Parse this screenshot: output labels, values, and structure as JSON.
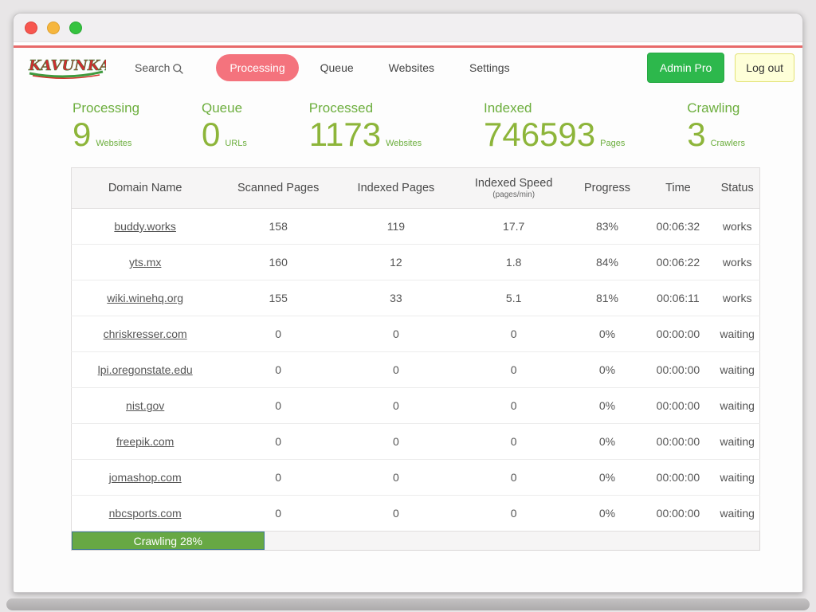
{
  "window": {
    "controls": [
      "close",
      "minimize",
      "maximize"
    ]
  },
  "navbar": {
    "logo_text": "KAVUNKA",
    "search_label": "Search",
    "items": [
      {
        "label": "Processing",
        "active": true
      },
      {
        "label": "Queue",
        "active": false
      },
      {
        "label": "Websites",
        "active": false
      },
      {
        "label": "Settings",
        "active": false
      }
    ],
    "admin_button": "Admin Pro",
    "logout_button": "Log out"
  },
  "stats": [
    {
      "label": "Processing",
      "value": "9",
      "unit": "Websites"
    },
    {
      "label": "Queue",
      "value": "0",
      "unit": "URLs"
    },
    {
      "label": "Processed",
      "value": "1173",
      "unit": "Websites"
    },
    {
      "label": "Indexed",
      "value": "746593",
      "unit": "Pages"
    },
    {
      "label": "Crawling",
      "value": "3",
      "unit": "Crawlers"
    }
  ],
  "table": {
    "headers": [
      "Domain Name",
      "Scanned Pages",
      "Indexed Pages",
      "Indexed Speed",
      "Progress",
      "Time",
      "Status"
    ],
    "speed_subtitle": "(pages/min)",
    "col_keys": [
      "domain",
      "scanned",
      "indexed",
      "speed",
      "progress",
      "time",
      "status"
    ],
    "rows": [
      {
        "domain": "buddy.works",
        "scanned": "158",
        "indexed": "119",
        "speed": "17.7",
        "progress": "83%",
        "time": "00:06:32",
        "status": "works"
      },
      {
        "domain": "yts.mx",
        "scanned": "160",
        "indexed": "12",
        "speed": "1.8",
        "progress": "84%",
        "time": "00:06:22",
        "status": "works"
      },
      {
        "domain": "wiki.winehq.org",
        "scanned": "155",
        "indexed": "33",
        "speed": "5.1",
        "progress": "81%",
        "time": "00:06:11",
        "status": "works"
      },
      {
        "domain": "chriskresser.com",
        "scanned": "0",
        "indexed": "0",
        "speed": "0",
        "progress": "0%",
        "time": "00:00:00",
        "status": "waiting"
      },
      {
        "domain": "lpi.oregonstate.edu",
        "scanned": "0",
        "indexed": "0",
        "speed": "0",
        "progress": "0%",
        "time": "00:00:00",
        "status": "waiting"
      },
      {
        "domain": "nist.gov",
        "scanned": "0",
        "indexed": "0",
        "speed": "0",
        "progress": "0%",
        "time": "00:00:00",
        "status": "waiting"
      },
      {
        "domain": "freepik.com",
        "scanned": "0",
        "indexed": "0",
        "speed": "0",
        "progress": "0%",
        "time": "00:00:00",
        "status": "waiting"
      },
      {
        "domain": "jomashop.com",
        "scanned": "0",
        "indexed": "0",
        "speed": "0",
        "progress": "0%",
        "time": "00:00:00",
        "status": "waiting"
      },
      {
        "domain": "nbcsports.com",
        "scanned": "0",
        "indexed": "0",
        "speed": "0",
        "progress": "0%",
        "time": "00:00:00",
        "status": "waiting"
      }
    ]
  },
  "footer": {
    "progress_label": "Crawling 28%",
    "progress_percent": 28
  },
  "colors": {
    "accent_green": "#2db84c",
    "stat_green": "#6cae3d",
    "active_pill": "#f4737d",
    "accent_red_line": "#e86a6a",
    "progress_fill": "#67a844"
  }
}
